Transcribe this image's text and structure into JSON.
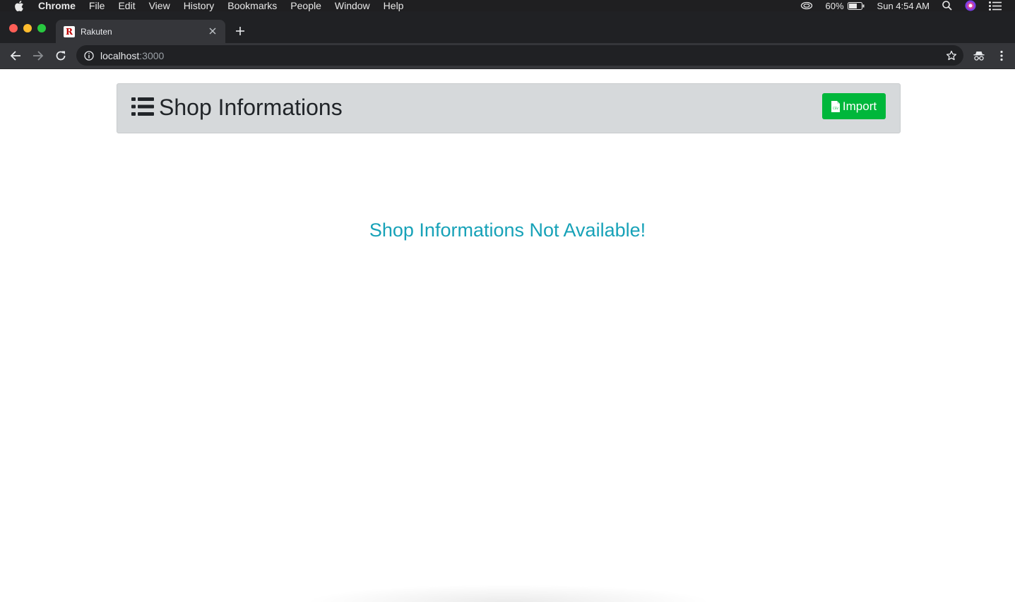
{
  "menubar": {
    "app_name": "Chrome",
    "items": [
      "File",
      "Edit",
      "View",
      "History",
      "Bookmarks",
      "People",
      "Window",
      "Help"
    ],
    "battery": "60%",
    "clock": "Sun 4:54 AM"
  },
  "browser": {
    "tab_title": "Rakuten",
    "favicon_letter": "R",
    "url_host": "localhost",
    "url_port": ":3000"
  },
  "header": {
    "title": "Shop Informations",
    "import_label": "Import"
  },
  "main": {
    "empty_message": "Shop Informations Not Available!"
  },
  "colors": {
    "import_button": "#00b73b",
    "empty_message": "#17a2b8",
    "header_bg": "#d6d9db"
  }
}
